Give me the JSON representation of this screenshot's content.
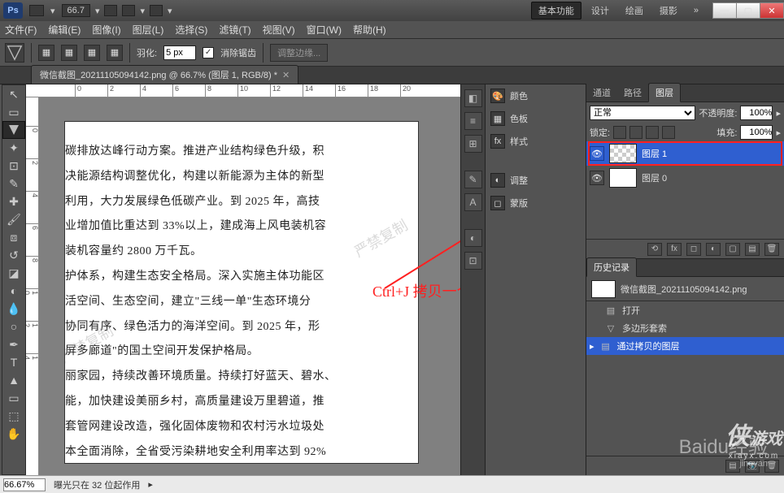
{
  "titlebar": {
    "zoom_display": "66.7",
    "ws1": "基本功能",
    "ws2": "设计",
    "ws3": "绘画",
    "ws4": "摄影"
  },
  "menus": [
    "文件(F)",
    "编辑(E)",
    "图像(I)",
    "图层(L)",
    "选择(S)",
    "滤镜(T)",
    "视图(V)",
    "窗口(W)",
    "帮助(H)"
  ],
  "optbar": {
    "feather_label": "羽化:",
    "feather_val": "5 px",
    "antialias": "消除锯齿",
    "refine": "调整边缘..."
  },
  "doctab": {
    "title": "微信截图_20211105094142.png @ 66.7% (图层 1, RGB/8) *"
  },
  "canvas_text": "碳排放达峰行动方案。推进产业结构绿色升级，积\n决能源结构调整优化，构建以新能源为主体的新型\n利用，大力发展绿色低碳产业。到 2025 年，高技\n业增加值比重达到 33%以上，建成海上风电装机容\n装机容量约 2800 万千瓦。\n护体系，构建生态安全格局。深入实施主体功能区\n活空间、生态空间，建立\"三线一单\"生态环境分\n协同有序、绿色活力的海洋空间。到 2025 年，形\n屏多廊道\"的国土空间开发保护格局。\n丽家园，持续改善环境质量。持续打好蓝天、碧水、\n能，加快建设美丽乡村，高质量建设万里碧道，推\n套管网建设改造，强化固体废物和农村污水垃圾处\n本全面消除，全省受污染耕地安全利用率达到 92%",
  "annotation": "Ctrl+J 拷贝一个图层",
  "right_col2": {
    "color": "颜色",
    "swatch": "色板",
    "style": "样式",
    "adjust": "调整",
    "mask": "蒙版"
  },
  "layers_panel": {
    "tabs": [
      "通道",
      "路径",
      "图层"
    ],
    "blend": "正常",
    "opacity_label": "不透明度:",
    "opacity": "100%",
    "lock_label": "锁定:",
    "fill_label": "填充:",
    "fill": "100%",
    "rows": [
      {
        "name": "图层 1",
        "selected": true
      },
      {
        "name": "图层 0",
        "selected": false
      }
    ]
  },
  "history_panel": {
    "title": "历史记录",
    "snapshot": "微信截图_20211105094142.png",
    "steps": [
      {
        "label": "打开",
        "icon": "▤"
      },
      {
        "label": "多边形套索",
        "icon": "▽"
      },
      {
        "label": "通过拷贝的图层",
        "icon": "▤",
        "selected": true
      }
    ]
  },
  "status": {
    "zoom": "66.67%",
    "info": "曝光只在 32 位起作用"
  },
  "watermark1": "严禁复制",
  "watermark2": "Baidu经验",
  "watermark3": "jingyan",
  "side_wm_main": "侠",
  "side_wm_sub": "游戏",
  "side_wm_url": "xiayx.com"
}
